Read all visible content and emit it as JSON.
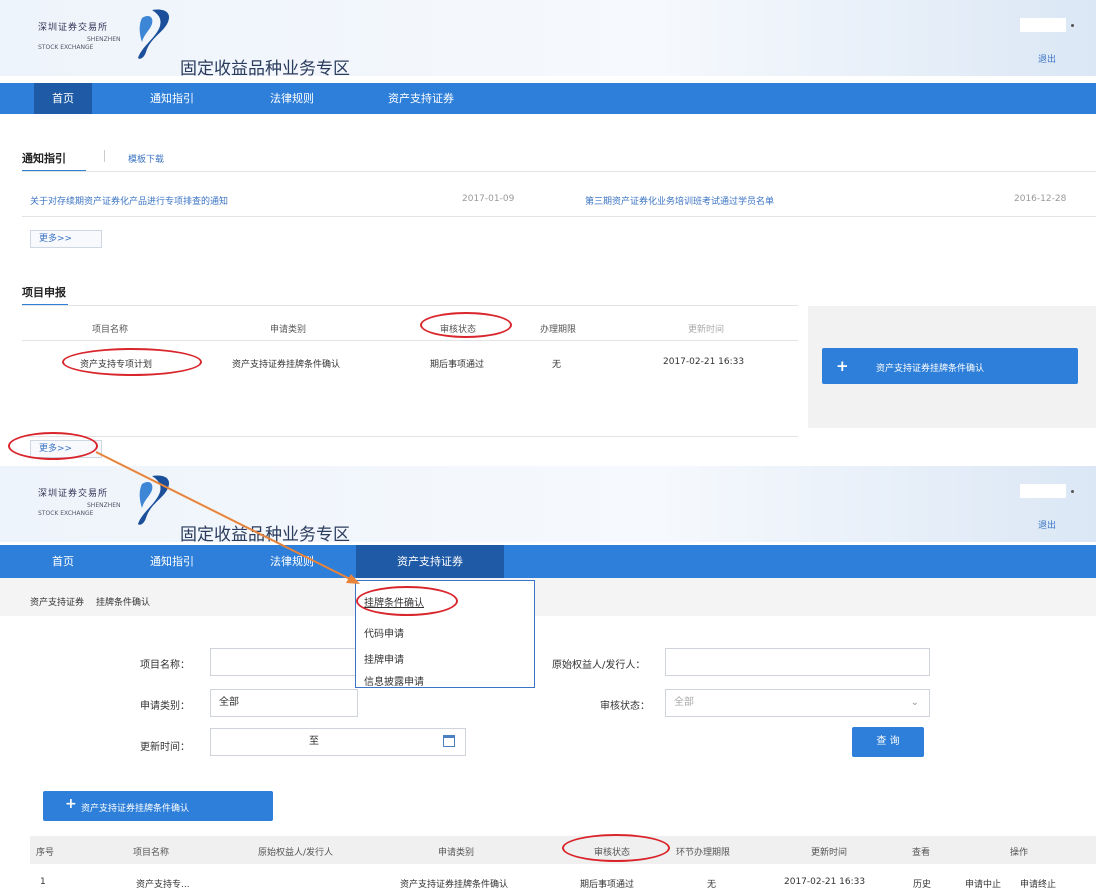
{
  "top": {
    "logo_cn": "深圳证券交易所",
    "logo_en_1": "SHENZHEN",
    "logo_en_2": "STOCK EXCHANGE",
    "zone_title": "固定收益品种业务专区",
    "logout": "退出",
    "nav": [
      "首页",
      "通知指引",
      "法律规则",
      "资产支持证券"
    ],
    "notice_section": {
      "title": "通知指引",
      "tab_download": "模板下载",
      "items": [
        {
          "title": "关于对存续期资产证券化产品进行专项排查的通知",
          "date": "2017-01-09"
        },
        {
          "title": "第三期资产证券化业务培训班考试通过学员名单",
          "date": "2016-12-28"
        }
      ],
      "more": "更多>>"
    },
    "project_section": {
      "title": "项目申报",
      "headers": [
        "项目名称",
        "申请类别",
        "审核状态",
        "办理期限",
        "更新时间"
      ],
      "row": {
        "name": "资产支持专项计划",
        "type": "资产支持证券挂牌条件确认",
        "status": "期后事项通过",
        "deadline": "无",
        "updated": "2017-02-21 16:33"
      },
      "more": "更多>>",
      "action_button": "资产支持证券挂牌条件确认"
    }
  },
  "bottom": {
    "logo_cn": "深圳证券交易所",
    "logo_en_1": "SHENZHEN",
    "logo_en_2": "STOCK EXCHANGE",
    "zone_title": "固定收益品种业务专区",
    "logout": "退出",
    "nav": [
      "首页",
      "通知指引",
      "法律规则",
      "资产支持证券"
    ],
    "breadcrumb": [
      "资产支持证券",
      "挂牌条件确认"
    ],
    "dropdown": [
      "挂牌条件确认",
      "代码申请",
      "挂牌申请",
      "信息披露申请"
    ],
    "form": {
      "project_name_label": "项目名称：",
      "applicant_label": "原始权益人/发行人：",
      "type_label": "申请类别：",
      "type_value": "全部",
      "status_label": "审核状态：",
      "status_value": "全部",
      "time_label": "更新时间：",
      "time_to": "至",
      "search_button": "查 询"
    },
    "add_button": "资产支持证券挂牌条件确认",
    "table": {
      "headers": [
        "序号",
        "项目名称",
        "原始权益人/发行人",
        "申请类别",
        "审核状态",
        "环节办理期限",
        "更新时间",
        "查看",
        "操作"
      ],
      "rows": [
        {
          "index": "1",
          "name": "资产支持专...",
          "applicant": "",
          "type": "资产支持证券挂牌条件确认",
          "status": "期后事项通过",
          "deadline": "无",
          "updated": "2017-02-21 16:33",
          "view": "历史",
          "op1": "申请中止",
          "op2": "申请终止"
        }
      ]
    }
  },
  "colors": {
    "nav_blue": "#2e7fd9",
    "nav_active": "#1f5aa6",
    "link_blue": "#3b74c4",
    "annotation_red": "#d9262c",
    "arrow_orange": "#e8833a"
  }
}
